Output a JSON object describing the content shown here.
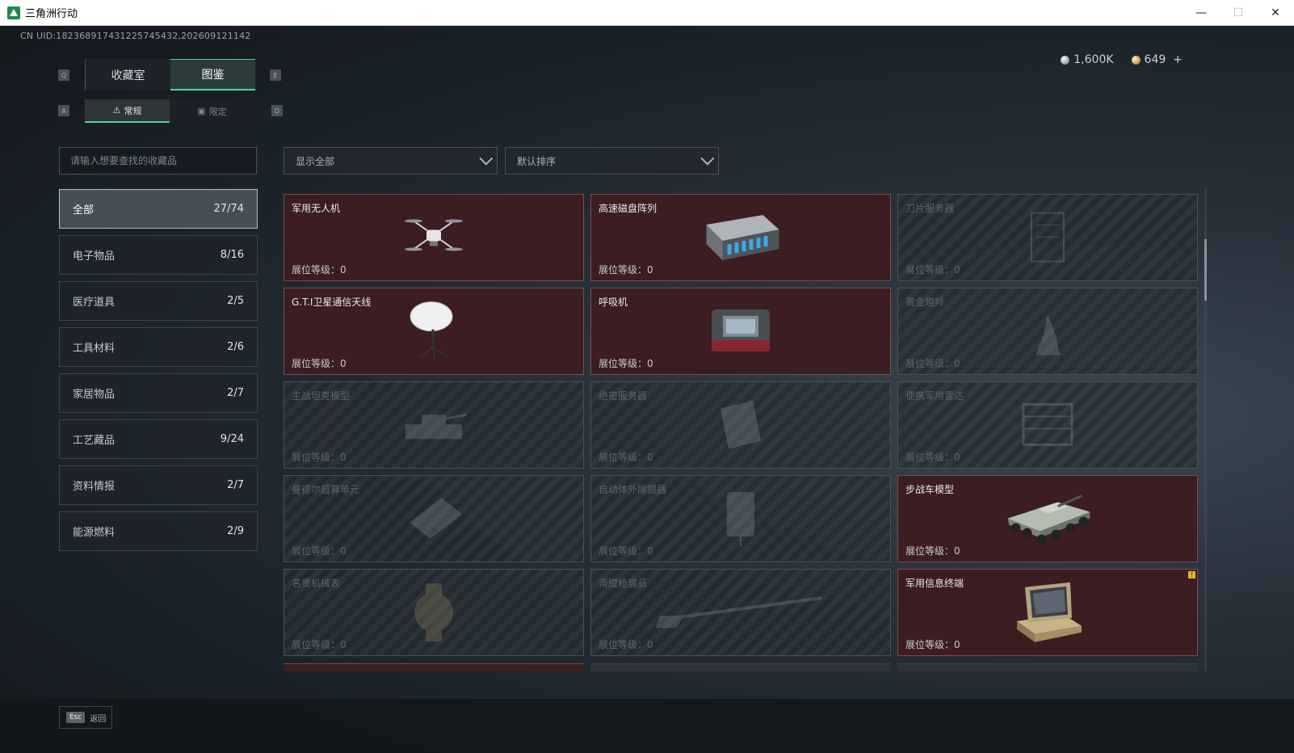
{
  "window": {
    "title": "三角洲行动"
  },
  "uid_text": "CN UID:18236891743122574543​2,202609121142",
  "currency": {
    "silver": "1,600K",
    "gold": "649",
    "add_symbol": "+"
  },
  "key_hints": {
    "prev_tab": "Q",
    "next_tab": "E",
    "prev_sub": "A",
    "next_sub": "D"
  },
  "main_tabs": [
    {
      "label": "收藏室"
    },
    {
      "label": "图鉴",
      "active": true
    }
  ],
  "sub_tabs": [
    {
      "label": "常规",
      "active": true
    },
    {
      "label": "限定"
    }
  ],
  "search": {
    "placeholder": "请输入想要查找的收藏品",
    "value": ""
  },
  "filters": {
    "display": "显示全部",
    "sort": "默认排序"
  },
  "categories": [
    {
      "label": "全部",
      "count": "27/74",
      "active": true
    },
    {
      "label": "电子物品",
      "count": "8/16"
    },
    {
      "label": "医疗道具",
      "count": "2/5"
    },
    {
      "label": "工具材料",
      "count": "2/6"
    },
    {
      "label": "家居物品",
      "count": "2/7"
    },
    {
      "label": "工艺藏品",
      "count": "9/24"
    },
    {
      "label": "资料情报",
      "count": "2/7"
    },
    {
      "label": "能源燃料",
      "count": "2/9"
    }
  ],
  "level_label": "展位等级：",
  "items": [
    {
      "name": "军用无人机",
      "level": "0",
      "unlocked": true,
      "icon": "drone-icon"
    },
    {
      "name": "高速磁盘阵列",
      "level": "0",
      "unlocked": true,
      "icon": "disk-array-icon"
    },
    {
      "name": "刀片服务器",
      "level": "0",
      "unlocked": false,
      "icon": "blade-server-icon"
    },
    {
      "name": "G.T.I卫星通信天线",
      "level": "0",
      "unlocked": true,
      "icon": "satellite-dish-icon"
    },
    {
      "name": "呼吸机",
      "level": "0",
      "unlocked": true,
      "icon": "ventilator-icon"
    },
    {
      "name": "黄金瞪羚",
      "level": "0",
      "unlocked": false,
      "icon": "gazelle-statue-icon"
    },
    {
      "name": "主战坦克模型",
      "level": "0",
      "unlocked": false,
      "icon": "tank-model-icon"
    },
    {
      "name": "绝密服务器",
      "level": "0",
      "unlocked": false,
      "icon": "secret-server-icon"
    },
    {
      "name": "便携军用雷达",
      "level": "0",
      "unlocked": false,
      "icon": "radar-icon"
    },
    {
      "name": "曼德尔超算单元",
      "level": "0",
      "unlocked": false,
      "icon": "supercomputer-icon"
    },
    {
      "name": "自动体外除颤器",
      "level": "0",
      "unlocked": false,
      "icon": "defibrillator-icon"
    },
    {
      "name": "步战车模型",
      "level": "0",
      "unlocked": true,
      "icon": "ifv-model-icon"
    },
    {
      "name": "名贵机械表",
      "level": "0",
      "unlocked": false,
      "icon": "watch-icon"
    },
    {
      "name": "滑膛枪展品",
      "level": "0",
      "unlocked": false,
      "icon": "musket-icon"
    },
    {
      "name": "军用信息终端",
      "level": "0",
      "unlocked": true,
      "icon": "terminal-icon",
      "alert": "!"
    }
  ],
  "footer": {
    "esc_key": "Esc",
    "back_label": "返回"
  },
  "colors": {
    "accent": "#4fd39a",
    "unlocked_card": "#3b1d22",
    "alert": "#e3b52b"
  }
}
